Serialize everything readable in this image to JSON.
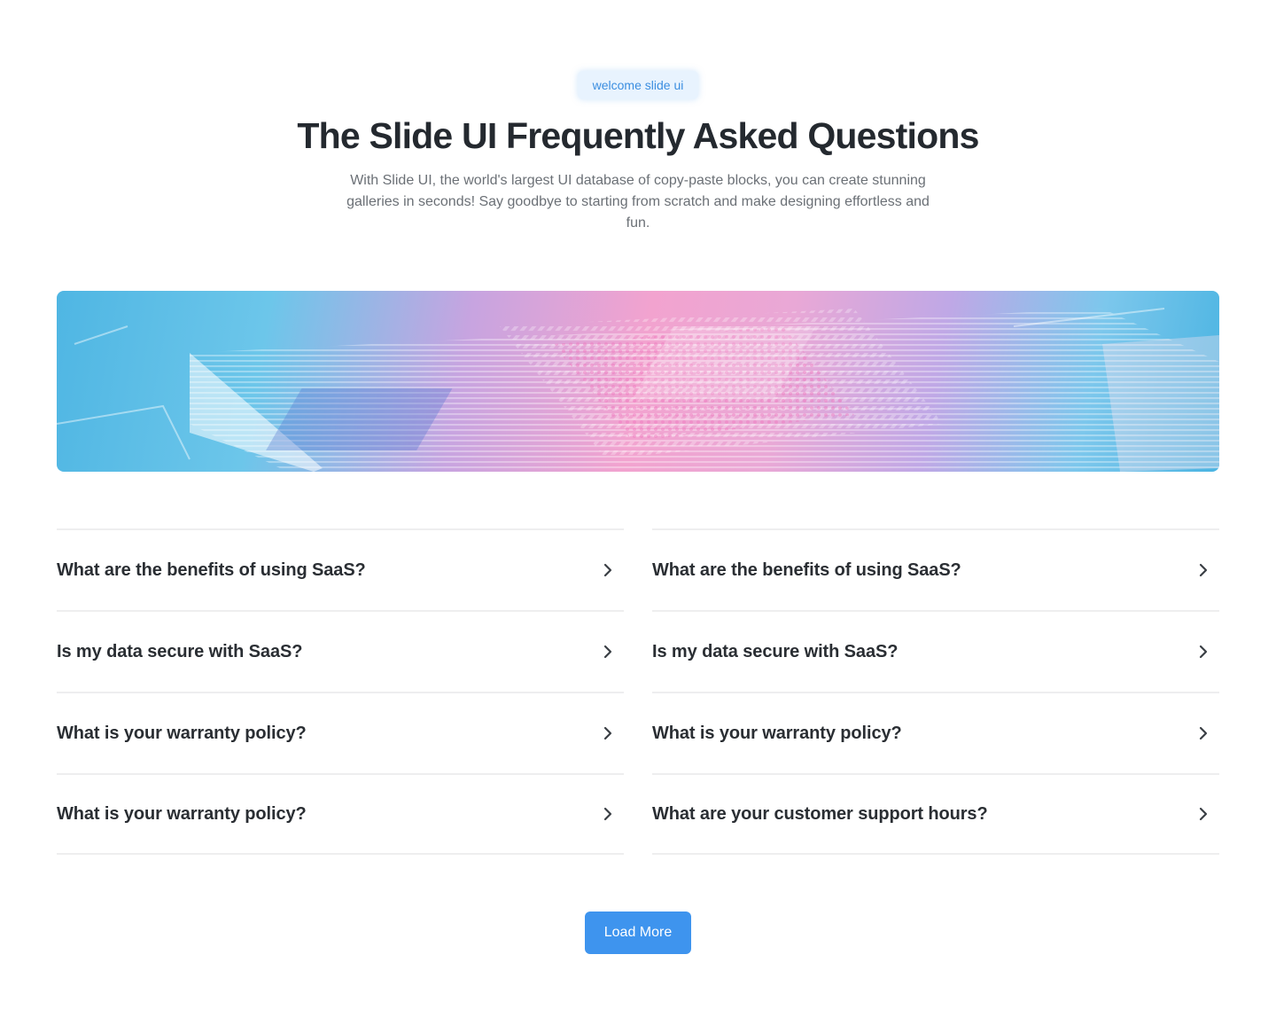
{
  "header": {
    "badge": "welcome slide ui",
    "title": "The Slide UI Frequently Asked Questions",
    "subtitle": "With Slide UI, the world's largest UI database of copy-paste blocks, you can create stunning galleries in seconds! Say goodbye to starting from scratch and make designing effortless and fun."
  },
  "hero_image": {
    "icon": "circuit-board-illustration"
  },
  "faq": {
    "left": [
      {
        "question": "What are the benefits of using SaaS?"
      },
      {
        "question": "Is my data secure with SaaS?"
      },
      {
        "question": "What is your warranty policy?"
      },
      {
        "question": "What is your warranty policy?"
      }
    ],
    "right": [
      {
        "question": "What are the benefits of using SaaS?"
      },
      {
        "question": "Is my data secure with SaaS?"
      },
      {
        "question": "What is your warranty policy?"
      },
      {
        "question": "What are your customer support hours?"
      }
    ],
    "expand_icon": "chevron-right-icon"
  },
  "load_more_label": "Load More",
  "colors": {
    "accent": "#3e94ee",
    "badge_bg": "#e8f3fe",
    "badge_text": "#3b8ee0"
  }
}
